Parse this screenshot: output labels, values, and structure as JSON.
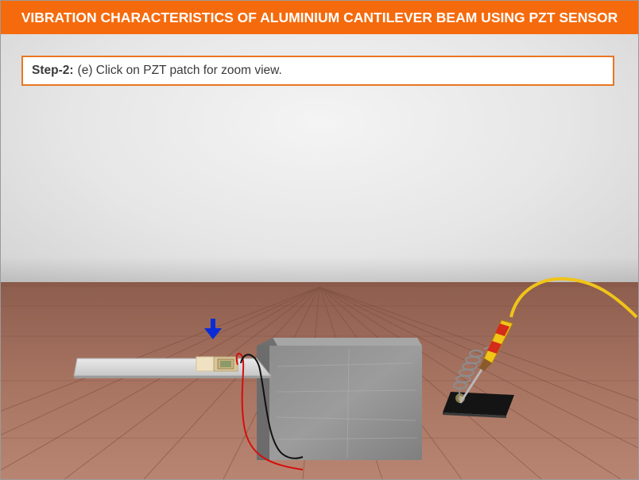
{
  "header": {
    "title": "VIBRATION CHARACTERISTICS OF ALUMINIUM CANTILEVER BEAM USING PZT SENSOR"
  },
  "instruction": {
    "step_label": "Step-2:",
    "text": "(e) Click on PZT patch for zoom view."
  },
  "colors": {
    "header_bg": "#f56a0c",
    "instruction_border": "#e87722",
    "pointer_arrow": "#0b2bd6"
  },
  "icons": {
    "pointer": "down-arrow-icon"
  }
}
